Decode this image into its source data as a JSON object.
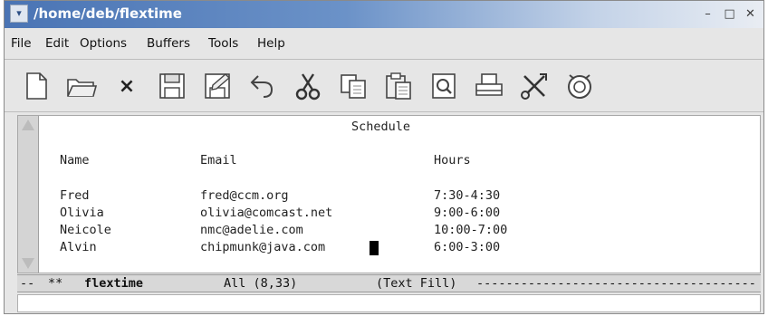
{
  "window": {
    "title": "/home/deb/flextime",
    "menu_glyph": "▾",
    "minimize_glyph": "–",
    "maximize_glyph": "□",
    "close_glyph": "✕"
  },
  "menubar": {
    "items": [
      "File",
      "Edit",
      "Options",
      "Buffers",
      "Tools",
      "Help"
    ]
  },
  "toolbar": {
    "tools": [
      "new-file-icon",
      "open-folder-icon",
      "close-icon",
      "save-icon",
      "save-as-icon",
      "undo-icon",
      "cut-icon",
      "copy-icon",
      "paste-icon",
      "search-icon",
      "print-icon",
      "customize-icon",
      "spell-check-icon"
    ],
    "close_glyph": "×"
  },
  "document": {
    "heading": "Schedule",
    "columns": [
      "Name",
      "Email",
      "Hours"
    ],
    "rows": [
      {
        "name": "Fred",
        "email": "fred@ccm.org",
        "hours": "7:30-4:30"
      },
      {
        "name": "Olivia",
        "email": "olivia@comcast.net",
        "hours": "9:00-6:00"
      },
      {
        "name": "Neicole",
        "email": "nmc@adelie.com",
        "hours": "10:00-7:00"
      },
      {
        "name": "Alvin",
        "email": "chipmunk@java.com",
        "hours": "6:00-3:00"
      }
    ]
  },
  "modeline": {
    "prefix": "--",
    "modified": "**",
    "buffer_name": "flextime",
    "position": "All (8,33)",
    "mode": "(Text Fill)",
    "fill": "-----------------------------------------------------------"
  },
  "colors": {
    "titlebar_start": "#4a74b4",
    "titlebar_end": "#e9edf3"
  }
}
